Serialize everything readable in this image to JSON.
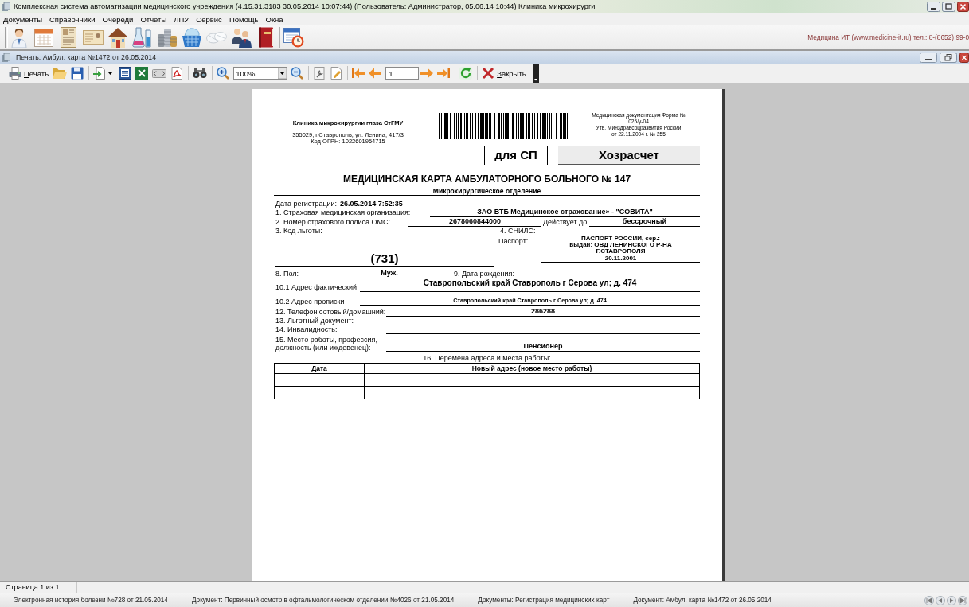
{
  "window": {
    "title": "Комплексная система автоматизации медицинского учреждения (4.15.31.3183 30.05.2014 10:07:44) (Пользователь: Администратор, 05.06.14 10:44) Клиника микрохирурги"
  },
  "menu": [
    "Документы",
    "Справочники",
    "Очереди",
    "Отчеты",
    "ЛПУ",
    "Сервис",
    "Помощь",
    "Окна"
  ],
  "vendor_info": "Медицина ИТ (www.medicine-it.ru) тел.: 8-(8652) 99-0",
  "child_window": {
    "title": "Печать: Амбул. карта №1472 от 26.05.2014"
  },
  "print_toolbar": {
    "print_label": "Печать",
    "zoom": "100%",
    "page": "1",
    "close_label": "Закрыть"
  },
  "document": {
    "clinic": {
      "name": "Клиника микрохирургии глаза СтГМУ",
      "address": "355029, г.Ставрополь, ул. Ленина, 417/3",
      "ogrn": "Код ОГРН: 1022601954715"
    },
    "form_note": [
      "Медицинская документация Форма №",
      "025/у-04",
      "Утв. Минздравсоцразвития России",
      "от 22.11.2004 г. № 255"
    ],
    "for_sp": "для СП",
    "payment": "Хозрасчет",
    "title": "МЕДИЦИНСКАЯ КАРТА АМБУЛАТОРНОГО БОЛЬНОГО № 147",
    "department": "Микрохирургическое отделение",
    "form": {
      "registration_date": {
        "label": "Дата регистрации:",
        "value": "26.05.2014 7:52:35"
      },
      "insurer": {
        "label": "1. Страховая медицинская организация:",
        "value": "ЗАО ВТБ Медицинское страхование» - \"СОВИТА\""
      },
      "policy_number": {
        "label": "2. Номер страхового полиса ОМС:",
        "value": "2678060844000"
      },
      "valid_until": {
        "label": "Действует до:",
        "value": "бессрочный"
      },
      "benefit_code": {
        "label": "3. Код льготы:",
        "value": "(731)"
      },
      "snils": {
        "label": "4. СНИЛС:"
      },
      "passport": {
        "label": "Паспорт:",
        "value_lines": [
          "ПАСПОРТ РОССИИ, сер.:",
          "выдан: ОВД ЛЕНИНСКОГО Р-НА",
          "Г.СТАВРОПОЛЯ",
          "20.11.2001"
        ]
      },
      "sex": {
        "label": "8. Пол:",
        "value": "Муж."
      },
      "birth_date": {
        "label": "9. Дата рождения:"
      },
      "actual_address": {
        "label": "10.1 Адрес фактический",
        "value": "Ставропольский край Ставрополь г Серова ул; д. 474"
      },
      "registered_address": {
        "label": "10.2 Адрес прописки",
        "value": "Ставропольский край Ставрополь г Серова ул; д. 474"
      },
      "phone": {
        "label": "12. Телефон сотовый/домашний:",
        "value": "286288"
      },
      "benefit_document": {
        "label": "13. Льготный документ:"
      },
      "disability": {
        "label": "14. Инвалидность:"
      },
      "workplace": {
        "label": "15. Место работы, профессия, должность (или иждевенец):",
        "value": "Пенсионер"
      }
    },
    "table": {
      "caption": "16. Перемена адреса и места работы:",
      "columns": [
        "Дата",
        "Новый адрес (новое место работы)"
      ]
    }
  },
  "status_bar": {
    "page_info": "Страница 1 из 1"
  },
  "window_list": [
    "Электронная история болезни №728 от 21.05.2014",
    "Документ: Первичный осмотр в офтальмологическом отделении №4026 от 21.05.2014",
    "Документы: Регистрация медицинских карт",
    "Документ: Амбул. карта №1472 от 26.05.2014"
  ]
}
